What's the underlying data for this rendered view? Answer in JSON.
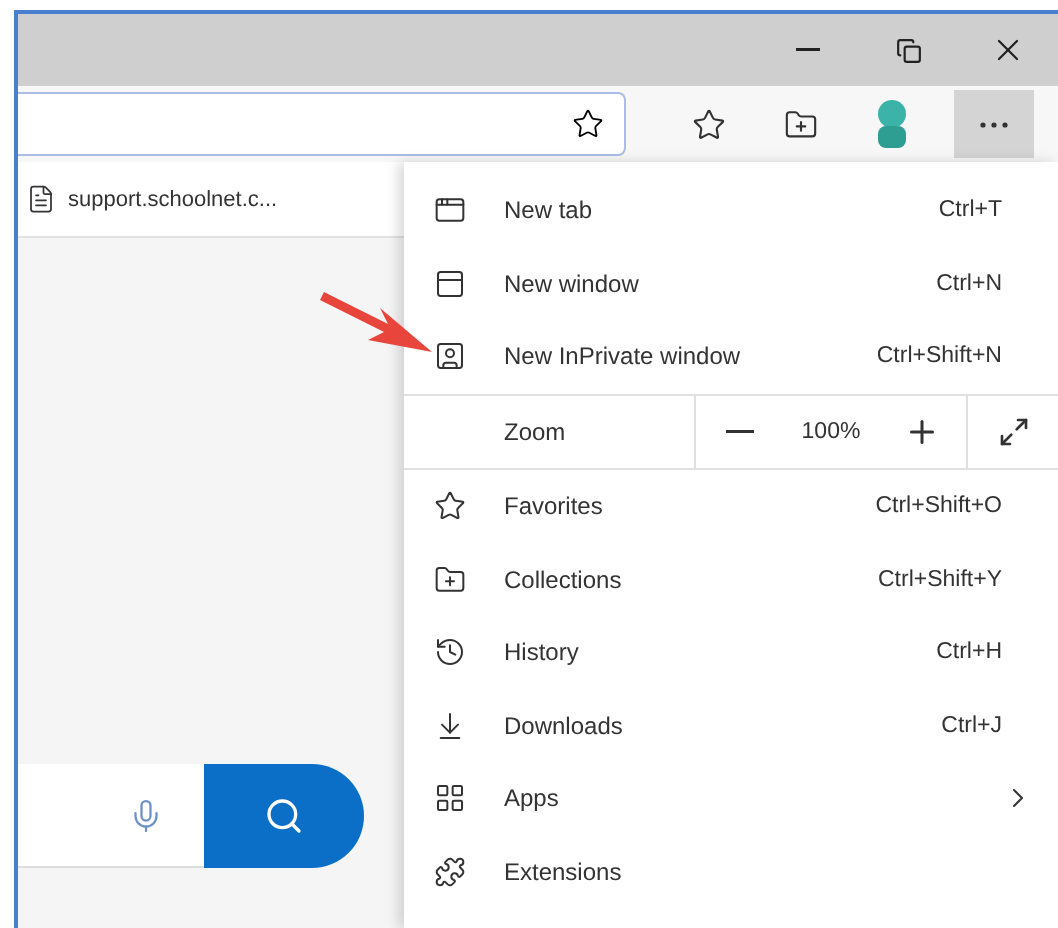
{
  "tab": {
    "title": "support.schoolnet.c..."
  },
  "menu": {
    "items": [
      {
        "kind": "item",
        "label": "New tab",
        "shortcut": "Ctrl+T"
      },
      {
        "kind": "item",
        "label": "New window",
        "shortcut": "Ctrl+N"
      },
      {
        "kind": "item",
        "label": "New InPrivate window",
        "shortcut": "Ctrl+Shift+N"
      },
      {
        "kind": "zoom",
        "label": "Zoom",
        "value": "100%"
      },
      {
        "kind": "item",
        "label": "Favorites",
        "shortcut": "Ctrl+Shift+O"
      },
      {
        "kind": "item",
        "label": "Collections",
        "shortcut": "Ctrl+Shift+Y"
      },
      {
        "kind": "item",
        "label": "History",
        "shortcut": "Ctrl+H"
      },
      {
        "kind": "item",
        "label": "Downloads",
        "shortcut": "Ctrl+J"
      },
      {
        "kind": "submenu",
        "label": "Apps"
      },
      {
        "kind": "item",
        "label": "Extensions"
      }
    ]
  }
}
